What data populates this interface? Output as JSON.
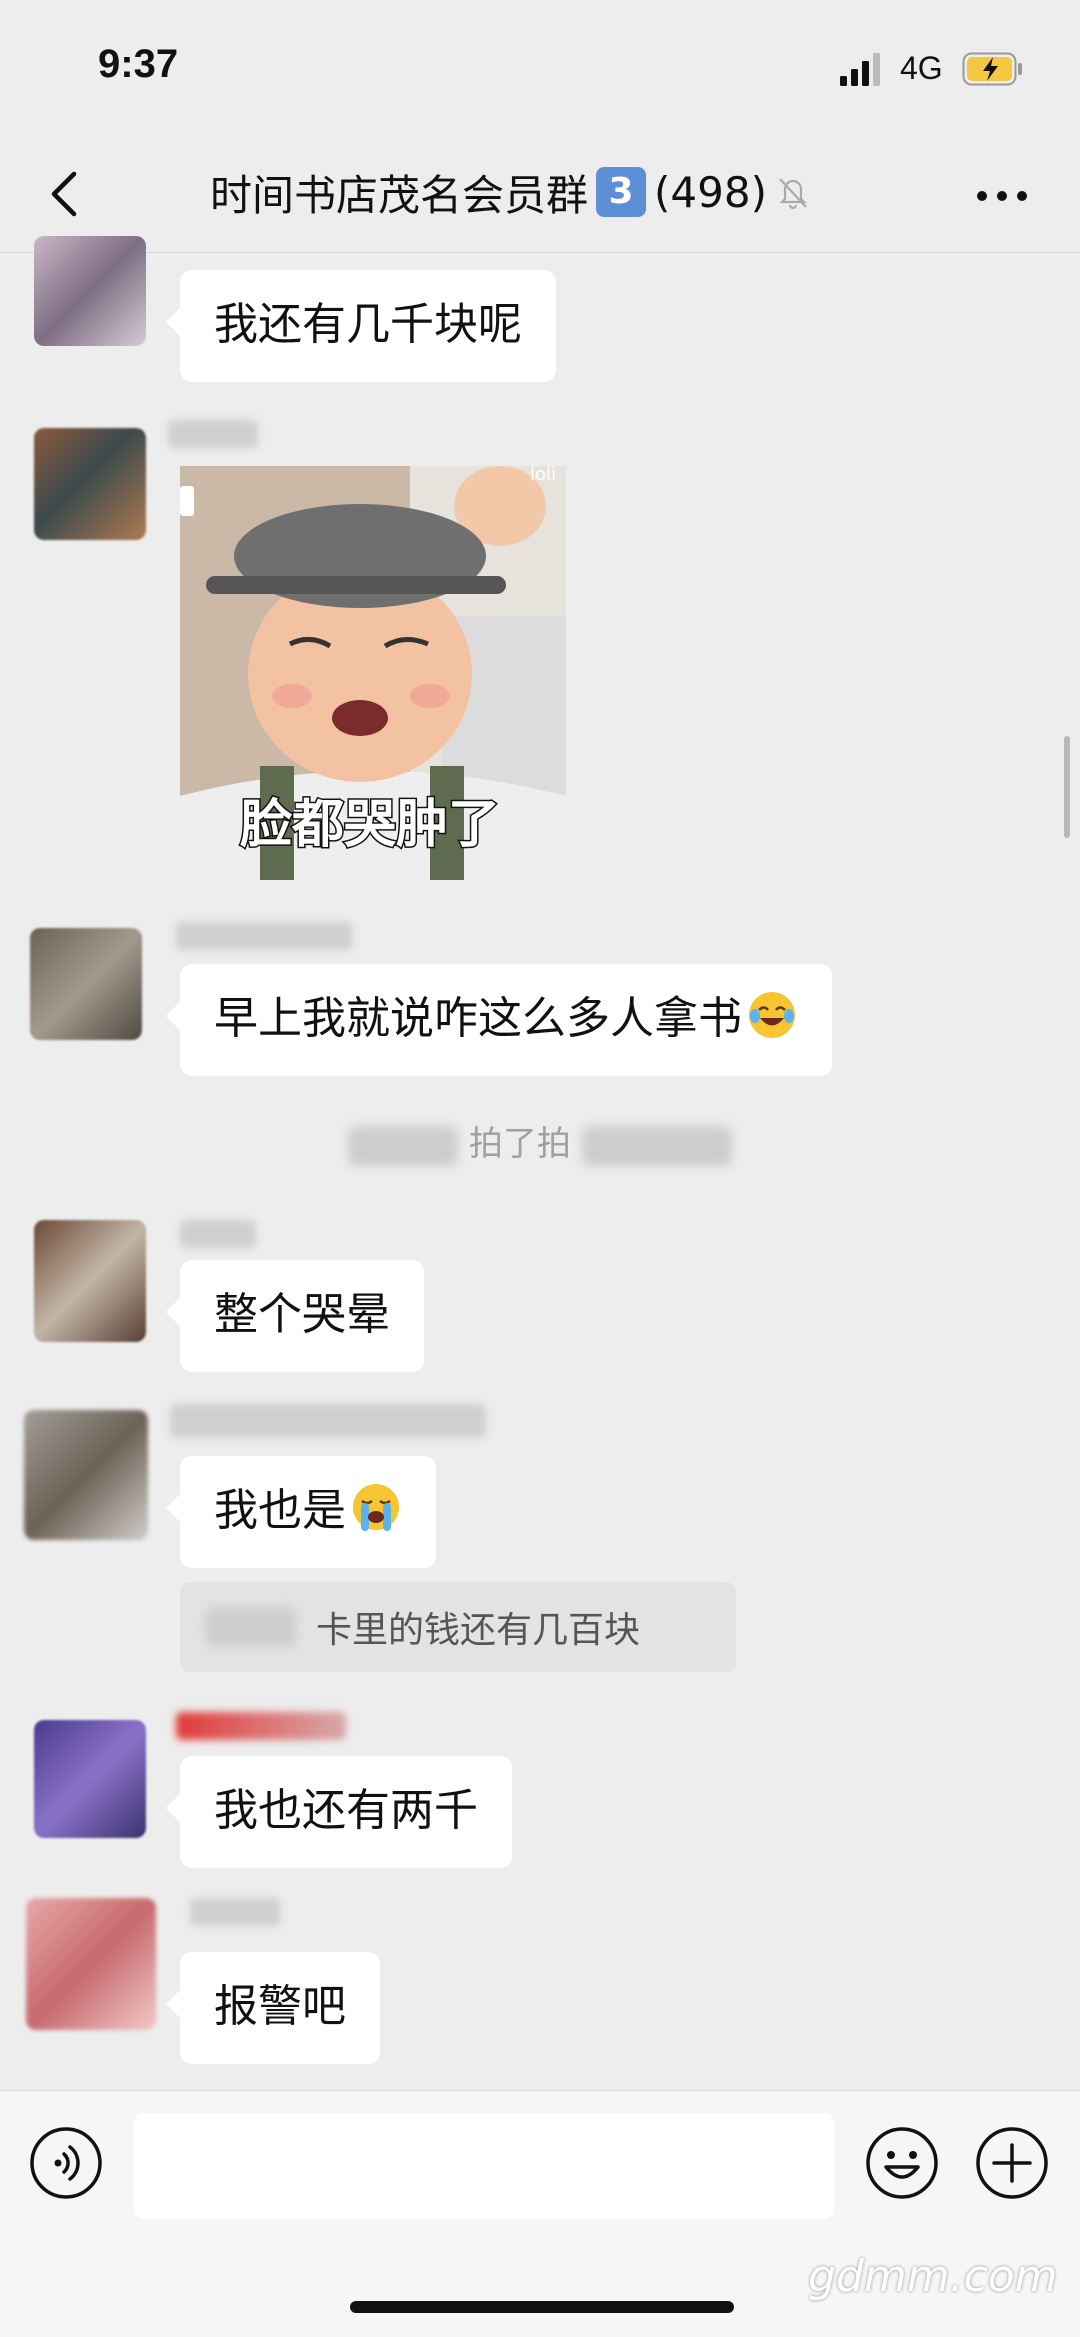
{
  "status_bar": {
    "time": "9:37",
    "network": "4G"
  },
  "header": {
    "title": "时间书店茂名会员群",
    "badge": "3",
    "member_count": "(498)"
  },
  "messages": [
    {
      "type": "text",
      "text": "我还有几千块呢"
    },
    {
      "type": "sticker",
      "caption": "脸都哭肿了",
      "corner_text": "loli"
    },
    {
      "type": "text",
      "text": "早上我就说咋这么多人拿书",
      "emoji": "face-with-tears-of-joy"
    },
    {
      "type": "system",
      "text": "拍了拍"
    },
    {
      "type": "text",
      "text": "整个哭晕"
    },
    {
      "type": "text",
      "text": "我也是",
      "emoji": "loudly-crying-face"
    },
    {
      "type": "quote",
      "text": "卡里的钱还有几百块"
    },
    {
      "type": "text",
      "text": "我也还有两千"
    },
    {
      "type": "text",
      "text": "报警吧"
    }
  ],
  "watermark": "gdmm.com",
  "colors": {
    "background": "#ededed",
    "bubble": "#ffffff",
    "badge": "#5d8fd6",
    "battery": "#f5c842"
  }
}
